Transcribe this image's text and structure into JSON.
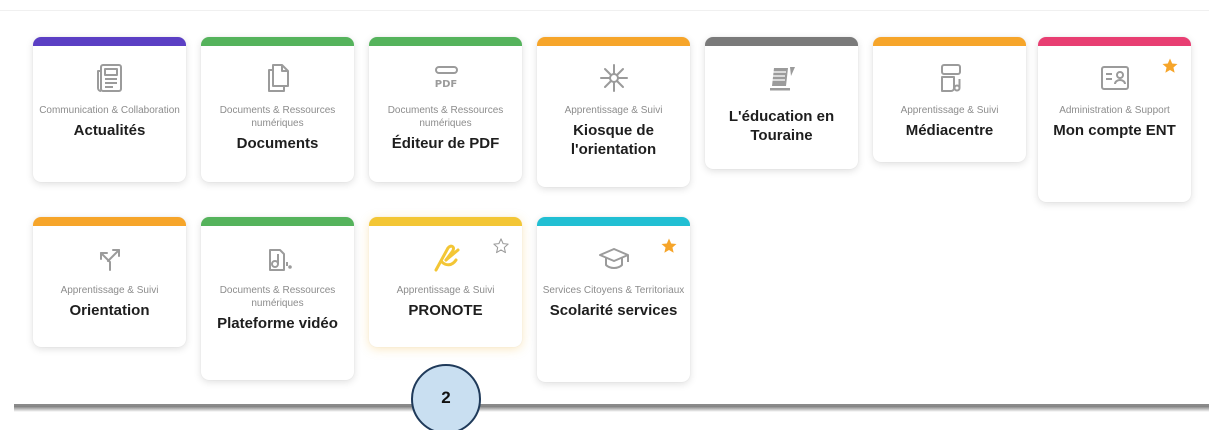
{
  "colors": {
    "communication": "#5b3fc4",
    "documents": "#55b35c",
    "apprentissage": "#f6a52a",
    "education": "#7a7a7a",
    "administration": "#e83e72",
    "pronote": "#f3c635",
    "services": "#21bfd3",
    "star_active": "#f6a52a",
    "icon": "#9b9b9b"
  },
  "tiles": [
    {
      "category": "Communication & Collaboration",
      "title": "Actualités",
      "icon": "newspaper-icon",
      "favorite": false
    },
    {
      "category": "Documents & Ressources numériques",
      "title": "Documents",
      "icon": "document-icon",
      "favorite": false
    },
    {
      "category": "Documents & Ressources numériques",
      "title": "Éditeur de PDF",
      "icon": "pdf-icon",
      "favorite": false
    },
    {
      "category": "Apprentissage & Suivi",
      "title": "Kiosque de l'orientation",
      "icon": "compass-rose-icon",
      "favorite": false
    },
    {
      "category": "",
      "title": "L'éducation en Touraine",
      "icon": "education-touraine-logo-icon",
      "favorite": false
    },
    {
      "category": "Apprentissage & Suivi",
      "title": "Médiacentre",
      "icon": "media-center-icon",
      "favorite": false
    },
    {
      "category": "Administration & Support",
      "title": "Mon compte ENT",
      "icon": "user-card-icon",
      "favorite": true
    },
    {
      "category": "Apprentissage & Suivi",
      "title": "Orientation",
      "icon": "split-arrows-icon",
      "favorite": false
    },
    {
      "category": "Documents & Ressources numériques",
      "title": "Plateforme vidéo",
      "icon": "video-file-icon",
      "favorite": false
    },
    {
      "category": "Apprentissage & Suivi",
      "title": "PRONOTE",
      "icon": "pronote-logo-icon",
      "favorite": false,
      "star_outline": true
    },
    {
      "category": "Services Citoyens & Territoriaux",
      "title": "Scolarité services",
      "icon": "graduation-cap-icon",
      "favorite": true
    }
  ],
  "badge": {
    "label": "2"
  }
}
